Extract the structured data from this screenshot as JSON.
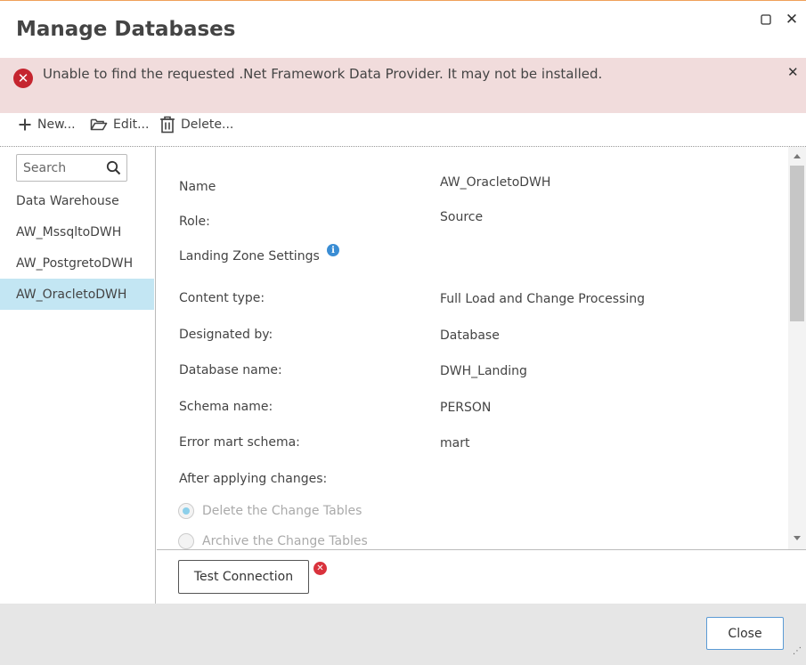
{
  "window": {
    "title": "Manage Databases",
    "maximize_icon": "maximize-icon",
    "close_icon": "close-icon",
    "close_glyph": "✕"
  },
  "error": {
    "message": "Unable to find the requested .Net Framework Data Provider. It may not be installed.",
    "icon": "error-icon",
    "icon_glyph": "✕",
    "dismiss_glyph": "✕",
    "color": "#c5252f",
    "background": "#f1dcdc"
  },
  "toolbar": {
    "new_label": "New...",
    "edit_label": "Edit...",
    "delete_label": "Delete..."
  },
  "sidebar": {
    "search_placeholder": "Search",
    "items": [
      {
        "label": "Data Warehouse",
        "selected": false
      },
      {
        "label": "AW_MssqltoDWH",
        "selected": false
      },
      {
        "label": "AW_PostgretoDWH",
        "selected": false
      },
      {
        "label": "AW_OracletoDWH",
        "selected": true
      }
    ],
    "selected_color": "#c3e6f3"
  },
  "details": {
    "name_label": "Name",
    "name_value": "AW_OracletoDWH",
    "role_label": "Role:",
    "role_value": "Source",
    "landing_zone_label": "Landing Zone Settings",
    "info_glyph": "i",
    "content_type_label": "Content type:",
    "content_type_value": "Full Load and Change Processing",
    "designated_by_label": "Designated by:",
    "designated_by_value": "Database",
    "database_name_label": "Database name:",
    "database_name_value": "DWH_Landing",
    "schema_name_label": "Schema name:",
    "schema_name_value": "PERSON",
    "error_mart_label": "Error mart schema:",
    "error_mart_value": "mart",
    "after_changes_label": "After applying changes:",
    "after_changes_options": [
      {
        "label": "Delete the Change Tables",
        "checked": true
      },
      {
        "label": "Archive the Change Tables",
        "checked": false
      }
    ]
  },
  "connection": {
    "test_label": "Test Connection",
    "status_icon": "error-status-icon",
    "status_glyph": "✕"
  },
  "footer": {
    "close_label": "Close",
    "resize_grip": "⋰"
  }
}
